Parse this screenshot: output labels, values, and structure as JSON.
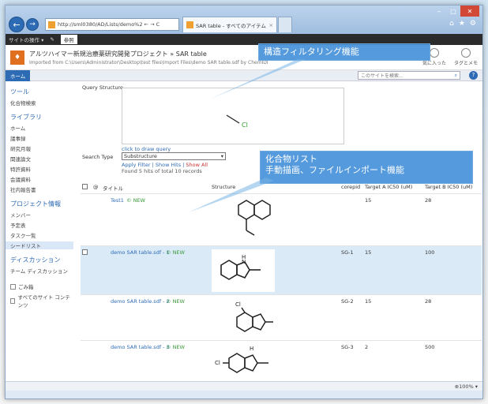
{
  "browser": {
    "address": "http://sml0380/AD/Lists/demo%2 ← → C",
    "tab_label": "SAR table - すべてのアイテム",
    "tab_close": "×"
  },
  "ribbon": {
    "site_actions": "サイトの操作 ▾",
    "browse": "参照"
  },
  "header": {
    "title": "アルツハイマー新規治療薬研究開発プロジェクト » SAR table",
    "subtitle": "Imported from C:\\Users\\Administrator\\Desktop\\test files\\Import Files\\demo SAR table.sdf by ChemIDI",
    "action_like": "気に入った",
    "action_tags": "タグとメモ"
  },
  "topnav": {
    "home": "ホーム",
    "search_placeholder": "このサイトを検索...",
    "search_icon": "⌕",
    "help_icon": "?"
  },
  "leftnav": {
    "tools_head": "ツール",
    "tools_item": "化合物検索",
    "library_head": "ライブラリ",
    "library_items": [
      "ホーム",
      "議事録",
      "研究月報",
      "関連論文",
      "特許資料",
      "会議資料",
      "社内報告書"
    ],
    "project_head": "プロジェクト情報",
    "project_items": [
      "メンバー",
      "予定表",
      "タスク一覧",
      "シードリスト"
    ],
    "discussion_head": "ディスカッション",
    "discussion_item": "チーム ディスカッション",
    "recycle": "ごみ箱",
    "all_content": "すべてのサイト コンテンツ"
  },
  "query": {
    "label": "Query Structure",
    "structure_text": "Cl",
    "click_to_draw": "click to draw query",
    "search_type_label": "Search Type",
    "search_type_value": "Substructure",
    "apply_filter": "Apply Filter",
    "show_hits": "Show Hits",
    "show_all": "Show All",
    "found": "Found 5 hits of total 10 records"
  },
  "table": {
    "columns": [
      "タイトル",
      "Structure",
      "corepid",
      "Target A IC50 (uM)",
      "Target B IC50 (uM)"
    ],
    "rows": [
      {
        "title": "Test1",
        "new": "© NEW",
        "corepid": "",
        "a": "15",
        "b": "28"
      },
      {
        "title": "demo SAR table.sdf - 1",
        "new": "© NEW",
        "corepid": "SG-1",
        "a": "15",
        "b": "100"
      },
      {
        "title": "demo SAR table.sdf - 2",
        "new": "© NEW",
        "corepid": "SG-2",
        "a": "15",
        "b": "28"
      },
      {
        "title": "demo SAR table.sdf - 3",
        "new": "© NEW",
        "corepid": "SG-3",
        "a": "2",
        "b": "500"
      }
    ]
  },
  "status": {
    "zoom": "⊕100% ▾"
  },
  "callouts": {
    "filter": "構造フィルタリング機能",
    "list_line1": "化合物リスト",
    "list_line2": "手動描画、ファイルインポート機能"
  },
  "colors": {
    "accent": "#2d6bb5",
    "callout": "#3c8cd7",
    "close": "#d14836"
  }
}
